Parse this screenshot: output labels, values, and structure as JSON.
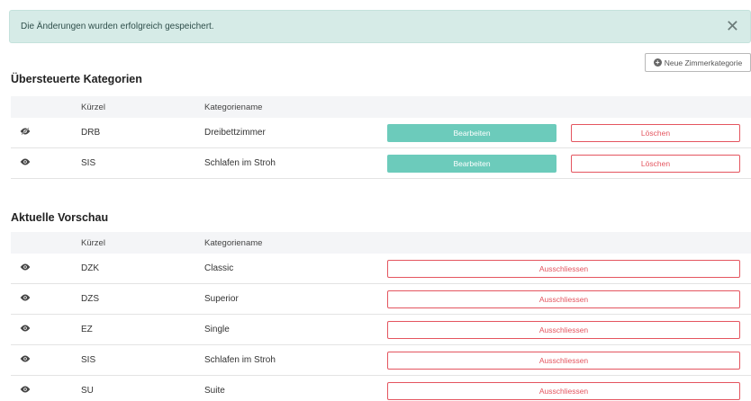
{
  "alert": {
    "message": "Die Änderungen wurden erfolgreich gespeichert.",
    "close_glyph": "✕"
  },
  "toolbar": {
    "new_category_label": "Neue Zimmerkategorie",
    "plus_glyph": "+"
  },
  "overridden": {
    "title": "Übersteuerte Kategorien",
    "columns": {
      "short": "Kürzel",
      "name": "Kategoriename"
    },
    "rows": [
      {
        "visible": false,
        "short": "DRB",
        "name": "Dreibettzimmer",
        "edit_label": "Bearbeiten",
        "delete_label": "Löschen"
      },
      {
        "visible": true,
        "short": "SIS",
        "name": "Schlafen im Stroh",
        "edit_label": "Bearbeiten",
        "delete_label": "Löschen"
      }
    ]
  },
  "preview": {
    "title": "Aktuelle Vorschau",
    "columns": {
      "short": "Kürzel",
      "name": "Kategoriename"
    },
    "rows": [
      {
        "visible": true,
        "short": "DZK",
        "name": "Classic",
        "exclude_label": "Ausschliessen"
      },
      {
        "visible": true,
        "short": "DZS",
        "name": "Superior",
        "exclude_label": "Ausschliessen"
      },
      {
        "visible": true,
        "short": "EZ",
        "name": "Single",
        "exclude_label": "Ausschliessen"
      },
      {
        "visible": true,
        "short": "SIS",
        "name": "Schlafen im Stroh",
        "exclude_label": "Ausschliessen"
      },
      {
        "visible": true,
        "short": "SU",
        "name": "Suite",
        "exclude_label": "Ausschliessen"
      }
    ]
  },
  "icons": {
    "eye": "eye-icon",
    "eye_slash": "eye-slash-icon",
    "close": "close-icon",
    "plus": "plus-circle-icon"
  },
  "colors": {
    "primary": "#6ccbbb",
    "danger": "#e4555f",
    "alert_bg": "#d6ebe7",
    "header_bg": "#f4f5f7"
  }
}
